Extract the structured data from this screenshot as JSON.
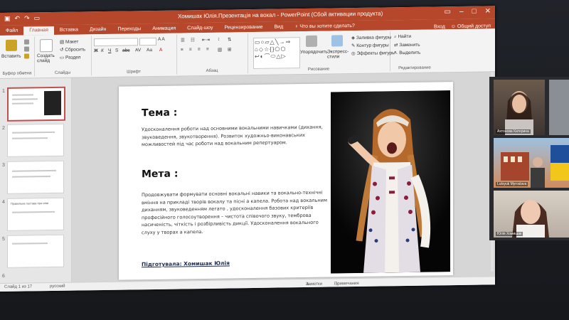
{
  "window": {
    "title": "Хомишак Юлія.Презентація на вокал - PowerPoint (Сбой активации продукта)",
    "signin": "Вход",
    "share": "Общий доступ"
  },
  "tabs": [
    "Файл",
    "Главная",
    "Вставка",
    "Дизайн",
    "Переходы",
    "Анимация",
    "Слайд-шоу",
    "Рецензирование",
    "Вид"
  ],
  "tell_me": "Что вы хотите сделать?",
  "ribbon": {
    "paste": "Вставить",
    "clipboard_group": "Буфер обмена",
    "new_slide": "Создать слайд",
    "layout": "Макет",
    "reset": "Сбросить",
    "section": "Раздел",
    "slides_group": "Слайды",
    "font_group": "Шрифт",
    "paragraph_group": "Абзац",
    "arrange": "Упорядочить",
    "quick_styles": "Экспресс-стили",
    "drawing_group": "Рисование",
    "shape_fill": "Заливка фигуры",
    "shape_outline": "Контур фигуры",
    "shape_effects": "Эффекты фигуры",
    "find": "Найти",
    "replace": "Заменить",
    "select": "Выделить",
    "editing_group": "Редактирование"
  },
  "slide": {
    "heading1": "Тема :",
    "para1": "Удосконалення роботи над основними вокальними навичками (дихання, звуковедення, звукотворення). Розвиток художньо-виконавських можливостей під час роботи над вокальним репертуаром.",
    "heading2": "Мета :",
    "para2": "Продовжувати формувати основні вокальні навики та вокально-технічні вміння на прикладі творів вокалу та пісні а капела. Робота над вокальним диханням, звуковеденням легато , удосконалення базових критеріїв професійного голосоутворення – чистота співочого звуку, темброва насиченість, чіткість і розбірливість дикції. Удосконалення вокального слуху у творах а капела.",
    "signature": "Підготувала: Хомишак Юлія"
  },
  "thumbnails": [
    {
      "number": "1"
    },
    {
      "number": "2"
    },
    {
      "number": "3"
    },
    {
      "number": "4",
      "caption": "Правильна постава при співі"
    },
    {
      "number": "5"
    },
    {
      "number": "6"
    }
  ],
  "status": {
    "slide_info": "Слайд 1 из 17",
    "language": "русский",
    "notes": "Заметки",
    "comments": "Примечания"
  },
  "video": {
    "participant1": "Ахтонова Катерина",
    "participant2": "Lutsyuk Myroslava",
    "participant3": "Юлія Хомишак"
  },
  "colors": {
    "accent": "#b7472a",
    "selected_thumb": "#c0504d"
  }
}
